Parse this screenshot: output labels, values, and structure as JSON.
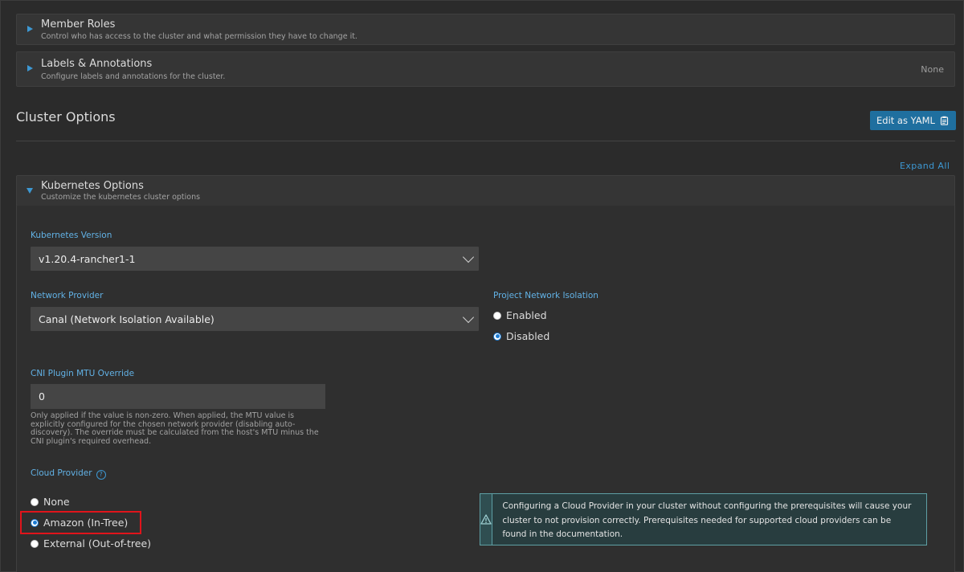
{
  "panels": {
    "member_roles": {
      "title": "Member Roles",
      "subtitle": "Control who has access to the cluster and what permission they have to change it."
    },
    "labels": {
      "title": "Labels & Annotations",
      "subtitle": "Configure labels and annotations for the cluster.",
      "value": "None"
    },
    "kubernetes": {
      "title": "Kubernetes Options",
      "subtitle": "Customize the kubernetes cluster options"
    }
  },
  "cluster_options": {
    "title": "Cluster Options",
    "edit_yaml_label": "Edit as YAML",
    "expand_all_label": "Expand All"
  },
  "form": {
    "k8s_version": {
      "label": "Kubernetes Version",
      "value": "v1.20.4-rancher1-1"
    },
    "network_provider": {
      "label": "Network Provider",
      "value": "Canal (Network Isolation Available)"
    },
    "project_network_isolation": {
      "label": "Project Network Isolation",
      "options": [
        "Enabled",
        "Disabled"
      ],
      "selected": "Disabled"
    },
    "cni_mtu": {
      "label": "CNI Plugin MTU Override",
      "value": "0",
      "help": "Only applied if the value is non-zero. When applied, the MTU value is explicitly configured for the chosen network provider (disabling auto-discovery). The override must be calculated from the host's MTU minus the CNI plugin's required overhead."
    },
    "cloud_provider": {
      "label": "Cloud Provider",
      "help_glyph": "?",
      "options": [
        "None",
        "Amazon (In-Tree)",
        "External (Out-of-tree)"
      ],
      "selected": "Amazon (In-Tree)"
    }
  },
  "banner": {
    "icon": "warning-triangle-icon",
    "message": "Configuring a Cloud Provider in your cluster without configuring the prerequisites will cause your cluster to not provision correctly. Prerequisites needed for supported cloud providers can be found in the documentation."
  },
  "colors": {
    "accent": "#3d98d3",
    "label": "#62b2e6",
    "highlight": "#e0141b",
    "banner_border": "#5e9fa4"
  }
}
